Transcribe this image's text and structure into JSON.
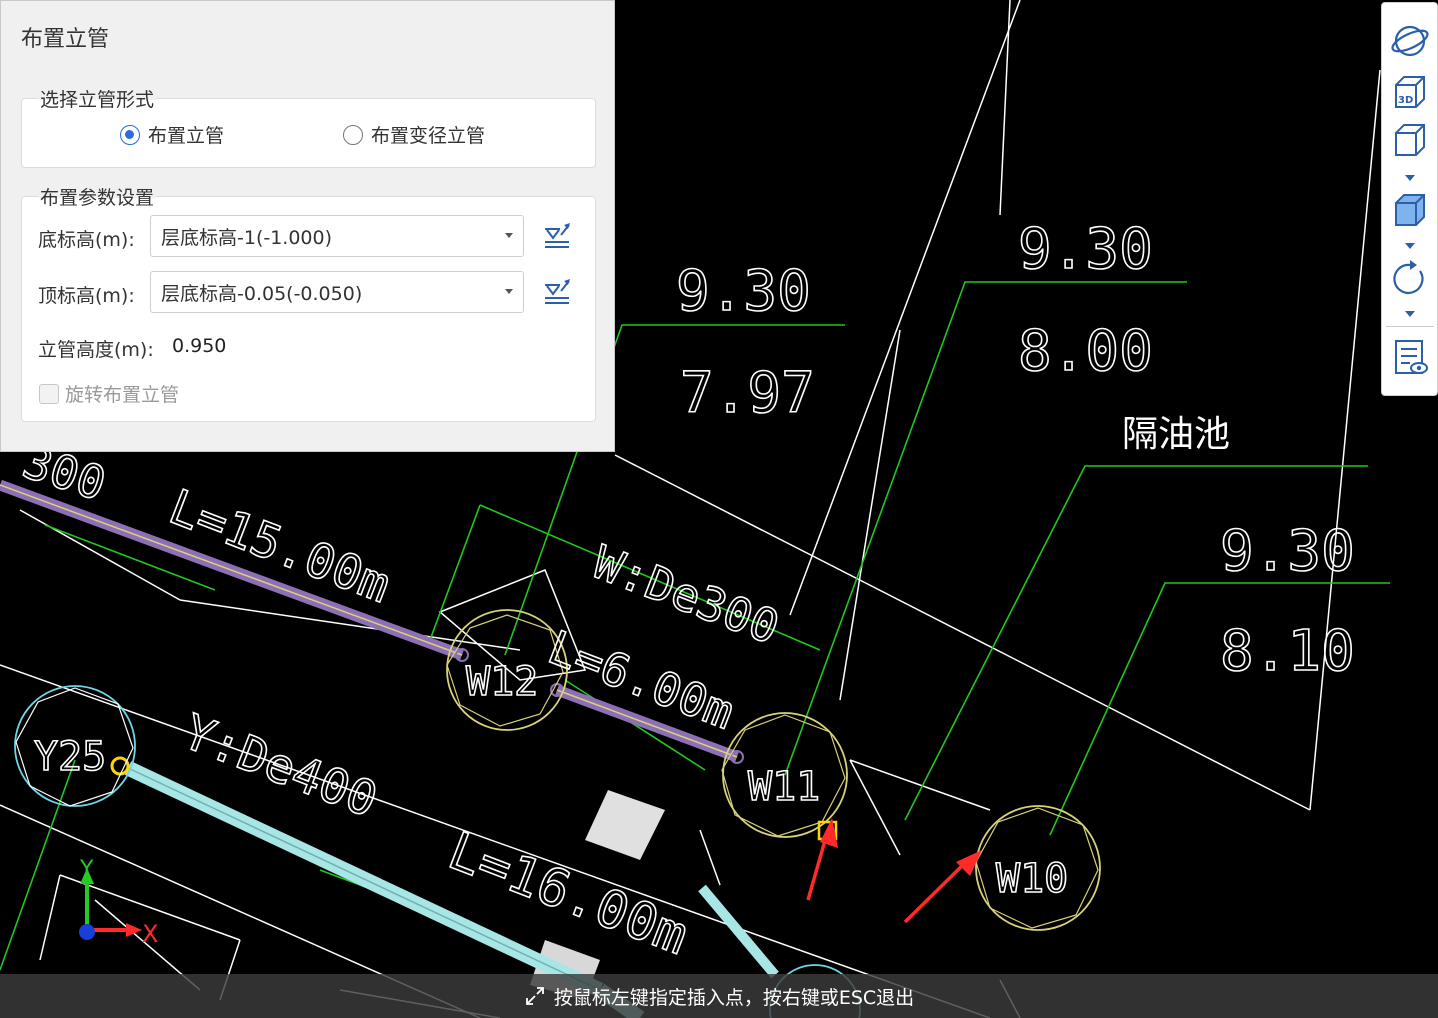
{
  "panel": {
    "title": "布置立管",
    "form_group": {
      "title": "选择立管形式",
      "options": [
        {
          "label": "布置立管",
          "checked": true
        },
        {
          "label": "布置变径立管",
          "checked": false
        }
      ]
    },
    "param_group": {
      "title": "布置参数设置",
      "bottom_elev_label": "底标高(m):",
      "bottom_elev_value": "层底标高-1(-1.000)",
      "top_elev_label": "顶标高(m):",
      "top_elev_value": "层底标高-0.05(-0.050)",
      "height_label": "立管高度(m):",
      "height_value": "0.950",
      "rotate_label": "旋转布置立管",
      "rotate_checked": false
    }
  },
  "toolbar": {
    "buttons": [
      "orbit-icon",
      "view-3d-icon",
      "box-view-icon",
      "solid-view-icon",
      "rotate-icon",
      "layer-display-icon"
    ]
  },
  "drawing": {
    "labels": {
      "a_top": "9.30",
      "a_bottom": "7.97",
      "b_top": "9.30",
      "b_bottom": "8.00",
      "c_title": "隔油池",
      "d_top": "9.30",
      "d_bottom": "8.10",
      "pipe1_length": "L=15.00m",
      "pipe1_spec": "W:De300",
      "pipe2_length": "L=6.00m",
      "pipe3_spec": "Y:De400",
      "pipe3_length": "L=16.00m",
      "partial_top": "300",
      "node_w12": "W12",
      "node_w11": "W11",
      "node_w10": "W10",
      "node_y25": "Y25",
      "axis_x": "X",
      "axis_y": "Y"
    },
    "colors": {
      "leader": "#1ec81e",
      "pipe_purple": "#8c6fb5",
      "pipe_cyan": "#a8e6e6",
      "node_ring": "#d8d27a",
      "arrow": "#ff2a2a",
      "highlight": "#ffd400"
    }
  },
  "status": {
    "message": "按鼠标左键指定插入点，按右键或ESC退出"
  }
}
